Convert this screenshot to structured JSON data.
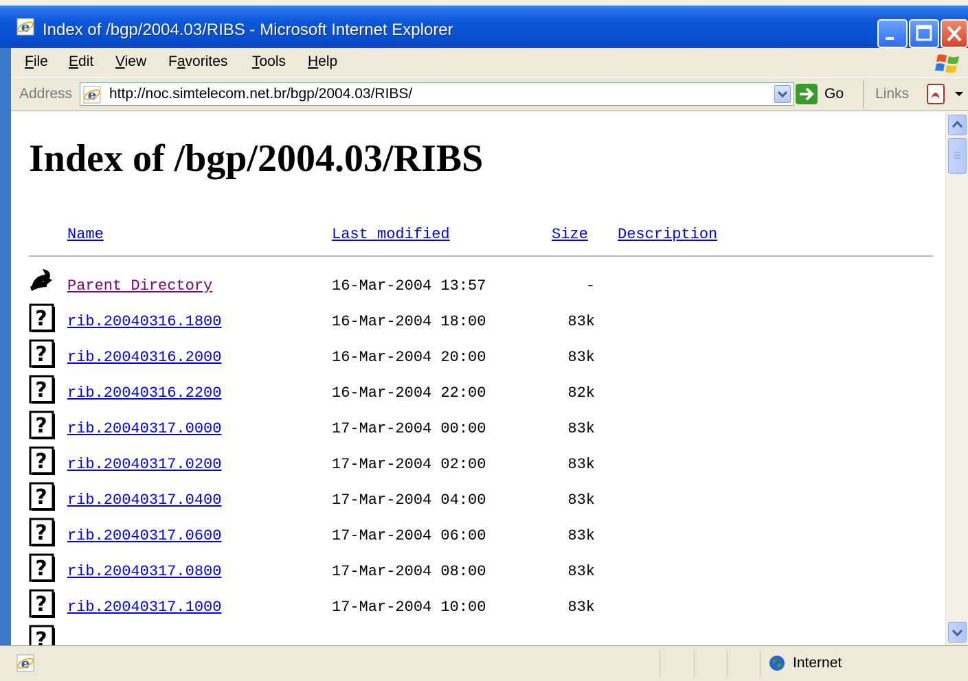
{
  "window": {
    "title": "Index of /bgp/2004.03/RIBS - Microsoft Internet Explorer"
  },
  "menu": {
    "items": [
      {
        "label": "File",
        "accel": "F"
      },
      {
        "label": "Edit",
        "accel": "E"
      },
      {
        "label": "View",
        "accel": "V"
      },
      {
        "label": "Favorites",
        "accel": "a"
      },
      {
        "label": "Tools",
        "accel": "T"
      },
      {
        "label": "Help",
        "accel": "H"
      }
    ]
  },
  "address": {
    "label": "Address",
    "url": "http://noc.simtelecom.net.br/bgp/2004.03/RIBS/",
    "go_label": "Go",
    "links_label": "Links"
  },
  "page": {
    "title": "Index of /bgp/2004.03/RIBS",
    "columns": {
      "name": "Name",
      "last_modified": "Last modified",
      "size": "Size",
      "description": "Description"
    },
    "rows": [
      {
        "name": "Parent Directory",
        "date": "16-Mar-2004 13:57",
        "size": "-",
        "icon": "back-arrow-icon",
        "visited": true
      },
      {
        "name": "rib.20040316.1800",
        "date": "16-Mar-2004 18:00",
        "size": "83k",
        "icon": "unknown-file-icon"
      },
      {
        "name": "rib.20040316.2000",
        "date": "16-Mar-2004 20:00",
        "size": "83k",
        "icon": "unknown-file-icon"
      },
      {
        "name": "rib.20040316.2200",
        "date": "16-Mar-2004 22:00",
        "size": "82k",
        "icon": "unknown-file-icon"
      },
      {
        "name": "rib.20040317.0000",
        "date": "17-Mar-2004 00:00",
        "size": "83k",
        "icon": "unknown-file-icon"
      },
      {
        "name": "rib.20040317.0200",
        "date": "17-Mar-2004 02:00",
        "size": "83k",
        "icon": "unknown-file-icon"
      },
      {
        "name": "rib.20040317.0400",
        "date": "17-Mar-2004 04:00",
        "size": "83k",
        "icon": "unknown-file-icon"
      },
      {
        "name": "rib.20040317.0600",
        "date": "17-Mar-2004 06:00",
        "size": "83k",
        "icon": "unknown-file-icon"
      },
      {
        "name": "rib.20040317.0800",
        "date": "17-Mar-2004 08:00",
        "size": "83k",
        "icon": "unknown-file-icon"
      },
      {
        "name": "rib.20040317.1000",
        "date": "17-Mar-2004 10:00",
        "size": "83k",
        "icon": "unknown-file-icon"
      },
      {
        "name": "",
        "date": "",
        "size": "",
        "icon": "unknown-file-icon"
      }
    ]
  },
  "status": {
    "zone": "Internet"
  },
  "colors": {
    "titlebar": "#0a56d8",
    "chrome": "#ece9d8",
    "link": "#0000ee",
    "visited_link": "#800080"
  }
}
